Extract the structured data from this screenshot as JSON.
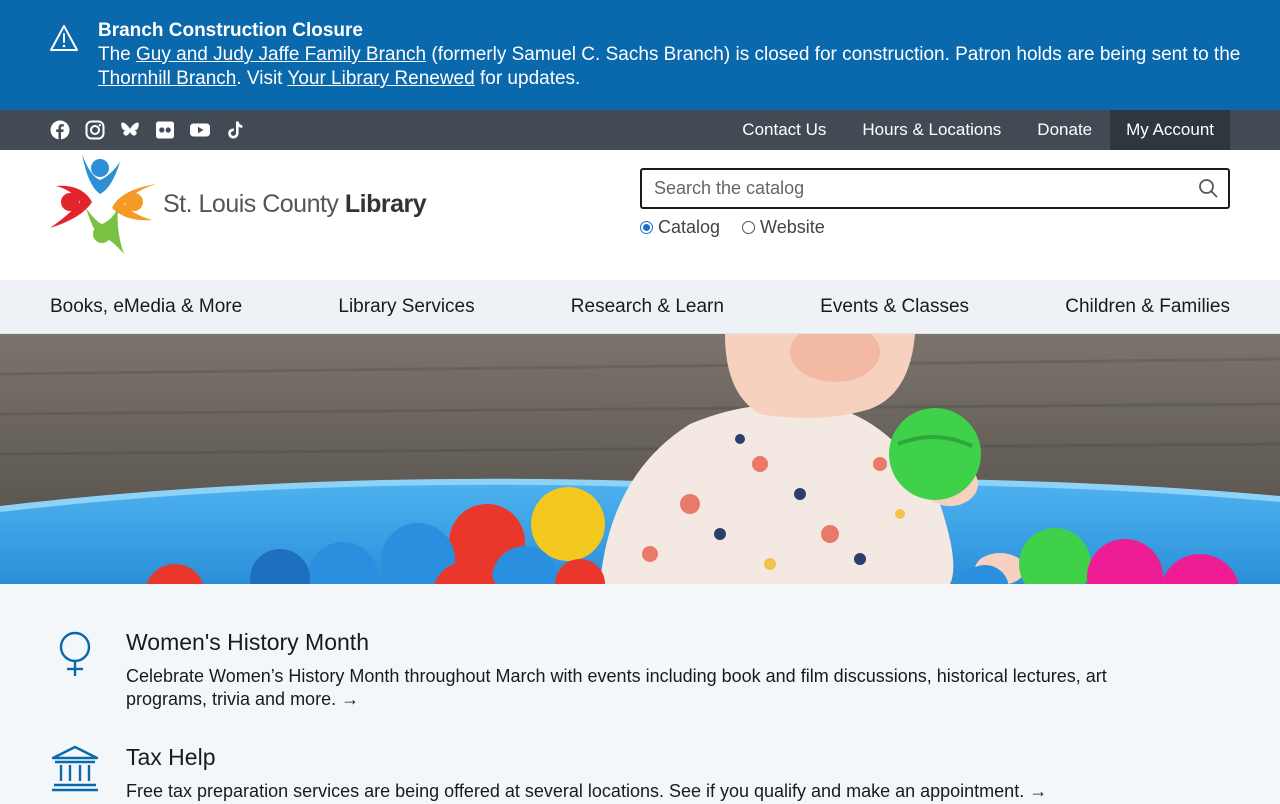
{
  "alert": {
    "title": "Branch Construction Closure",
    "text_1": "The ",
    "link_1": "Guy and Judy Jaffe Family Branch",
    "text_2": " (formerly Samuel C. Sachs Branch) is closed for construction. Patron holds are being sent to the ",
    "link_2": "Thornhill Branch",
    "text_3": ". Visit ",
    "link_3": "Your Library Renewed",
    "text_4": " for updates."
  },
  "social_icons": [
    "facebook-icon",
    "instagram-icon",
    "bluesky-icon",
    "flickr-icon",
    "youtube-icon",
    "tiktok-icon"
  ],
  "util_links": {
    "contact": "Contact Us",
    "hours": "Hours & Locations",
    "donate": "Donate",
    "account": "My Account"
  },
  "logo": {
    "text_regular": "St. Louis County ",
    "text_bold": "Library"
  },
  "search": {
    "placeholder": "Search the catalog",
    "value": ""
  },
  "search_scope": {
    "catalog": "Catalog",
    "website": "Website",
    "selected": "Catalog"
  },
  "main_nav": {
    "books": "Books, eMedia & More",
    "services": "Library Services",
    "research": "Research & Learn",
    "events": "Events & Classes",
    "children": "Children & Families"
  },
  "news": [
    {
      "title": "Women's History Month",
      "desc": "Celebrate Women’s History Month throughout March with events including book and film discussions, historical lectures, art programs, trivia and more. →",
      "icon": "female-symbol-icon"
    },
    {
      "title": "Tax Help",
      "desc": "Free tax preparation services are being offered at several locations. See if you qualify and make an appointment. →",
      "icon": "government-building-icon"
    }
  ],
  "colors": {
    "alert_bg": "#0a68ad",
    "utilbar_bg": "#424b54",
    "nav_bg": "#eef2f6",
    "icon_blue": "#0a68ad"
  }
}
